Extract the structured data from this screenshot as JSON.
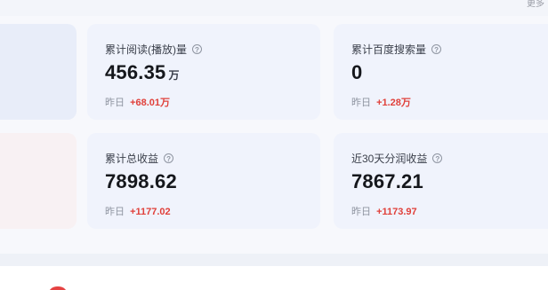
{
  "header": {
    "top_right_link": "更多"
  },
  "metrics": [
    {
      "title": "累计阅读(播放)量",
      "value": "456.35",
      "unit": "万",
      "yesterday_label": "昨日",
      "yesterday_delta": "+68.01万"
    },
    {
      "title": "累计百度搜索量",
      "value": "0",
      "unit": "",
      "yesterday_label": "昨日",
      "yesterday_delta": "+1.28万"
    },
    {
      "title": "累计总收益",
      "value": "7898.62",
      "unit": "",
      "yesterday_label": "昨日",
      "yesterday_delta": "+1177.02"
    },
    {
      "title": "近30天分润收益",
      "value": "7867.21",
      "unit": "",
      "yesterday_label": "昨日",
      "yesterday_delta": "+1173.97"
    }
  ],
  "colors": {
    "delta_positive": "#e0403a",
    "card_background": "#f0f3fc",
    "brand_red": "#e54242"
  },
  "icons": {
    "help": "help-circle-icon"
  }
}
